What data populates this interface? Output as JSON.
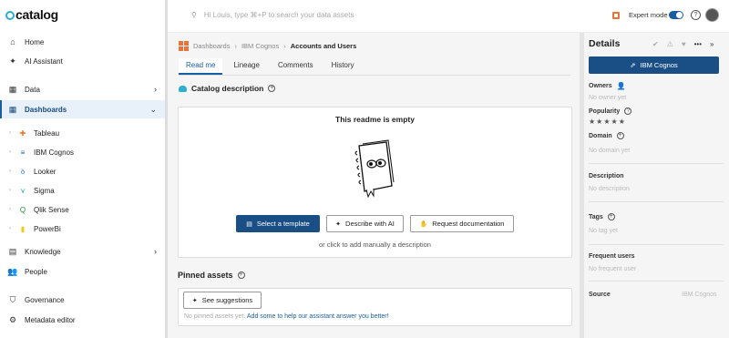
{
  "brand": {
    "name": "catalog"
  },
  "sidebar": {
    "items": [
      {
        "label": "Home"
      },
      {
        "label": "AI Assistant"
      },
      {
        "label": "Data"
      },
      {
        "label": "Dashboards"
      },
      {
        "label": "Knowledge"
      },
      {
        "label": "People"
      },
      {
        "label": "Governance"
      },
      {
        "label": "Metadata editor"
      }
    ],
    "dashboards": [
      {
        "label": "Tableau"
      },
      {
        "label": "IBM Cognos"
      },
      {
        "label": "Looker"
      },
      {
        "label": "Sigma"
      },
      {
        "label": "Qlik Sense"
      },
      {
        "label": "PowerBi"
      }
    ]
  },
  "topbar": {
    "search_placeholder": "Hi Louis, type ⌘+P to search your data assets",
    "expert_mode": "Expert mode",
    "help": "?"
  },
  "breadcrumb": {
    "items": [
      "Dashboards",
      "IBM Cognos"
    ],
    "current": "Accounts and Users",
    "sep": "›"
  },
  "tabs": [
    "Read me",
    "Lineage",
    "Comments",
    "History"
  ],
  "readme": {
    "section_title": "Catalog description",
    "empty_title": "This readme is empty",
    "select_template": "Select a template",
    "describe_ai": "Describe with AI",
    "request_doc": "Request documentation",
    "manual": "or click to add manually a description"
  },
  "pinned": {
    "title": "Pinned assets",
    "suggestions": "See suggestions",
    "empty": "No pinned assets yet.",
    "cta": "Add some to help our assistant answer you better!"
  },
  "details": {
    "title": "Details",
    "source_button": "IBM Cognos",
    "owners_label": "Owners",
    "owners_value": "No owner yet",
    "popularity_label": "Popularity",
    "popularity_stars": "★★★★★",
    "domain_label": "Domain",
    "domain_value": "No domain yet",
    "description_label": "Description",
    "description_value": "No description",
    "tags_label": "Tags",
    "tags_value": "No tag yet",
    "frequent_label": "Frequent users",
    "frequent_value": "No frequent user",
    "source_label": "Source",
    "source_value": "IBM Cognos"
  },
  "colors": {
    "accent": "#1a4f86",
    "brand": "#2bb0d0",
    "active_bg": "#e8f0fa"
  }
}
